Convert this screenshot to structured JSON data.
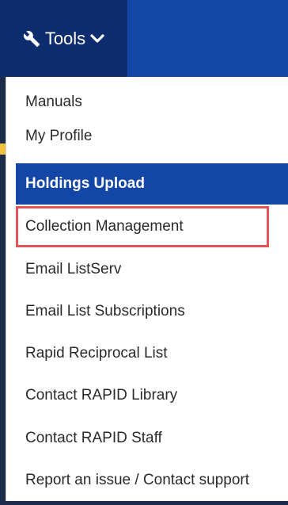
{
  "navbar": {
    "tools_label": "Tools",
    "colors": {
      "bar": "#1446a8",
      "toggle": "#0d2d6e",
      "highlight_border": "#e4535a"
    }
  },
  "menu": {
    "items": [
      {
        "label": "Manuals"
      },
      {
        "label": "My Profile"
      },
      {
        "label": "Holdings Upload",
        "state": "active"
      },
      {
        "label": "Collection Management",
        "state": "highlighted"
      },
      {
        "label": "Email ListServ"
      },
      {
        "label": "Email List Subscriptions"
      },
      {
        "label": "Rapid Reciprocal List"
      },
      {
        "label": "Contact RAPID Library"
      },
      {
        "label": "Contact RAPID Staff"
      },
      {
        "label": "Report an issue / Contact support"
      }
    ]
  }
}
